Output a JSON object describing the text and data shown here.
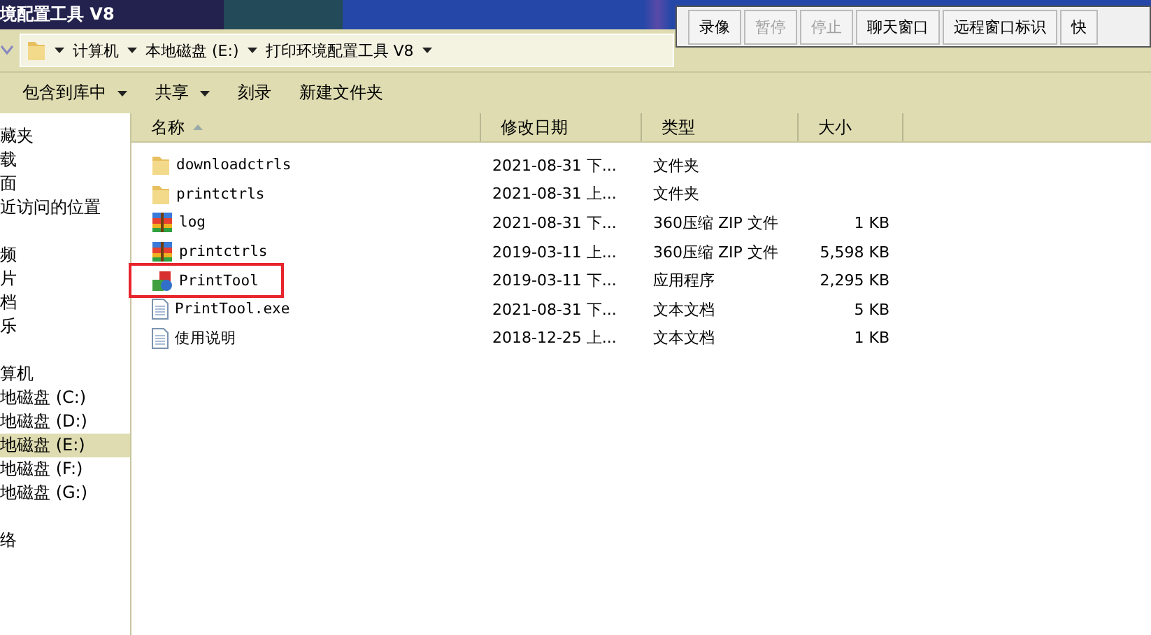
{
  "window": {
    "title": "境配置工具 V8"
  },
  "recorder_toolbar": [
    {
      "label": "录像",
      "disabled": false
    },
    {
      "label": "暂停",
      "disabled": true
    },
    {
      "label": "停止",
      "disabled": true
    },
    {
      "label": "聊天窗口",
      "disabled": false
    },
    {
      "label": "远程窗口标识",
      "disabled": false
    },
    {
      "label": "快",
      "disabled": false
    }
  ],
  "breadcrumb": [
    "计算机",
    "本地磁盘 (E:)",
    "打印环境配置工具 V8"
  ],
  "commands": [
    {
      "label": "包含到库中",
      "dropdown": true
    },
    {
      "label": "共享",
      "dropdown": true
    },
    {
      "label": "刻录",
      "dropdown": false
    },
    {
      "label": "新建文件夹",
      "dropdown": false
    }
  ],
  "sidebar": {
    "groups": [
      {
        "items": [
          {
            "label": "藏夹",
            "selected": false
          },
          {
            "label": "载",
            "selected": false
          },
          {
            "label": "面",
            "selected": false
          },
          {
            "label": "近访问的位置",
            "selected": false
          }
        ]
      },
      {
        "items": [
          {
            "label": "频",
            "selected": false
          },
          {
            "label": "片",
            "selected": false
          },
          {
            "label": "档",
            "selected": false
          },
          {
            "label": "乐",
            "selected": false
          }
        ]
      },
      {
        "items": [
          {
            "label": "算机",
            "selected": false
          },
          {
            "label": "地磁盘 (C:)",
            "selected": false
          },
          {
            "label": "地磁盘 (D:)",
            "selected": false
          },
          {
            "label": "地磁盘 (E:)",
            "selected": true
          },
          {
            "label": "地磁盘 (F:)",
            "selected": false
          },
          {
            "label": "地磁盘 (G:)",
            "selected": false
          }
        ]
      },
      {
        "items": [
          {
            "label": "络",
            "selected": false
          }
        ]
      }
    ]
  },
  "table": {
    "columns": [
      "名称",
      "修改日期",
      "类型",
      "大小"
    ],
    "rows": [
      {
        "kind": "folder",
        "name": "downloadctrls",
        "date": "2021-08-31 下...",
        "type": "文件夹",
        "size": "",
        "highlighted": false
      },
      {
        "kind": "folder",
        "name": "printctrls",
        "date": "2021-08-31 上...",
        "type": "文件夹",
        "size": "",
        "highlighted": false
      },
      {
        "kind": "zip",
        "name": "log",
        "date": "2021-08-31 下...",
        "type": "360压缩 ZIP 文件",
        "size": "1 KB",
        "highlighted": false
      },
      {
        "kind": "zip",
        "name": "printctrls",
        "date": "2019-03-11 上...",
        "type": "360压缩 ZIP 文件",
        "size": "5,598 KB",
        "highlighted": false
      },
      {
        "kind": "app",
        "name": "PrintTool",
        "date": "2019-03-11 下...",
        "type": "应用程序",
        "size": "2,295 KB",
        "highlighted": true
      },
      {
        "kind": "text",
        "name": "PrintTool.exe",
        "date": "2021-08-31 下...",
        "type": "文本文档",
        "size": "5 KB",
        "highlighted": false
      },
      {
        "kind": "text",
        "name": "使用说明",
        "date": "2018-12-25 上...",
        "type": "文本文档",
        "size": "1 KB",
        "highlighted": false
      }
    ]
  }
}
